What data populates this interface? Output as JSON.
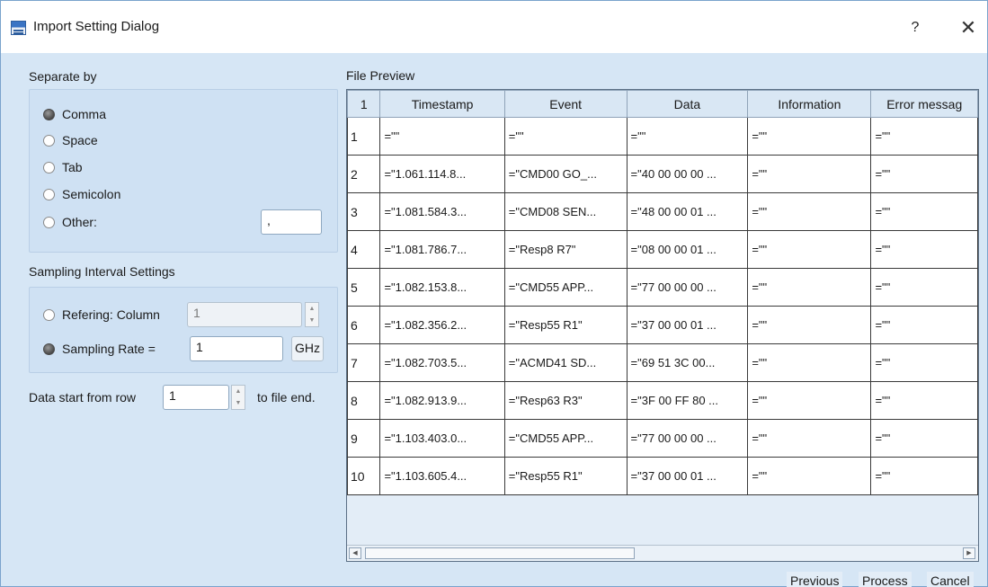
{
  "window": {
    "title": "Import Setting Dialog",
    "help_label": "?",
    "close_label": "✕"
  },
  "separator": {
    "heading": "Separate by",
    "options": [
      {
        "label": "Comma",
        "checked": true
      },
      {
        "label": "Space",
        "checked": false
      },
      {
        "label": "Tab",
        "checked": false
      },
      {
        "label": "Semicolon",
        "checked": false
      },
      {
        "label": "Other:",
        "checked": false
      }
    ],
    "other_value": ","
  },
  "sampling": {
    "heading": "Sampling Interval Settings",
    "refering_label": "Refering: Column",
    "refering_value": "1",
    "rate_label": "Sampling Rate =",
    "rate_value": "1",
    "rate_unit": "GHz"
  },
  "start_row": {
    "label_before": "Data start from row",
    "value": "1",
    "label_after": "to file end."
  },
  "preview": {
    "heading": "File Preview",
    "corner_label": "1",
    "columns": [
      "Timestamp",
      "Event",
      "Data",
      "Information",
      "Error messag"
    ],
    "rows": [
      [
        "1",
        "=\"\"",
        "=\"\"",
        "=\"\"",
        "=\"\"",
        "=\"\""
      ],
      [
        "2",
        "=\"1.061.114.8...",
        "=\"CMD00 GO_...",
        "=\"40 00 00 00 ...",
        "=\"\"",
        "=\"\""
      ],
      [
        "3",
        "=\"1.081.584.3...",
        "=\"CMD08 SEN...",
        "=\"48 00 00 01 ...",
        "=\"\"",
        "=\"\""
      ],
      [
        "4",
        "=\"1.081.786.7...",
        "=\"Resp8 R7\"",
        "=\"08 00 00 01 ...",
        "=\"\"",
        "=\"\""
      ],
      [
        "5",
        "=\"1.082.153.8...",
        "=\"CMD55 APP...",
        "=\"77 00 00 00 ...",
        "=\"\"",
        "=\"\""
      ],
      [
        "6",
        "=\"1.082.356.2...",
        "=\"Resp55 R1\"",
        "=\"37 00 00 01 ...",
        "=\"\"",
        "=\"\""
      ],
      [
        "7",
        "=\"1.082.703.5...",
        "=\"ACMD41 SD...",
        "=\"69 51 3C 00...",
        "=\"\"",
        "=\"\""
      ],
      [
        "8",
        "=\"1.082.913.9...",
        "=\"Resp63 R3\"",
        "=\"3F 00 FF 80 ...",
        "=\"\"",
        "=\"\""
      ],
      [
        "9",
        "=\"1.103.403.0...",
        "=\"CMD55 APP...",
        "=\"77 00 00 00 ...",
        "=\"\"",
        "=\"\""
      ],
      [
        "10",
        "=\"1.103.605.4...",
        "=\"Resp55 R1\"",
        "=\"37 00 00 01 ...",
        "=\"\"",
        "=\"\""
      ]
    ]
  },
  "buttons": {
    "previous": "Previous",
    "process": "Process",
    "cancel": "Cancel"
  }
}
